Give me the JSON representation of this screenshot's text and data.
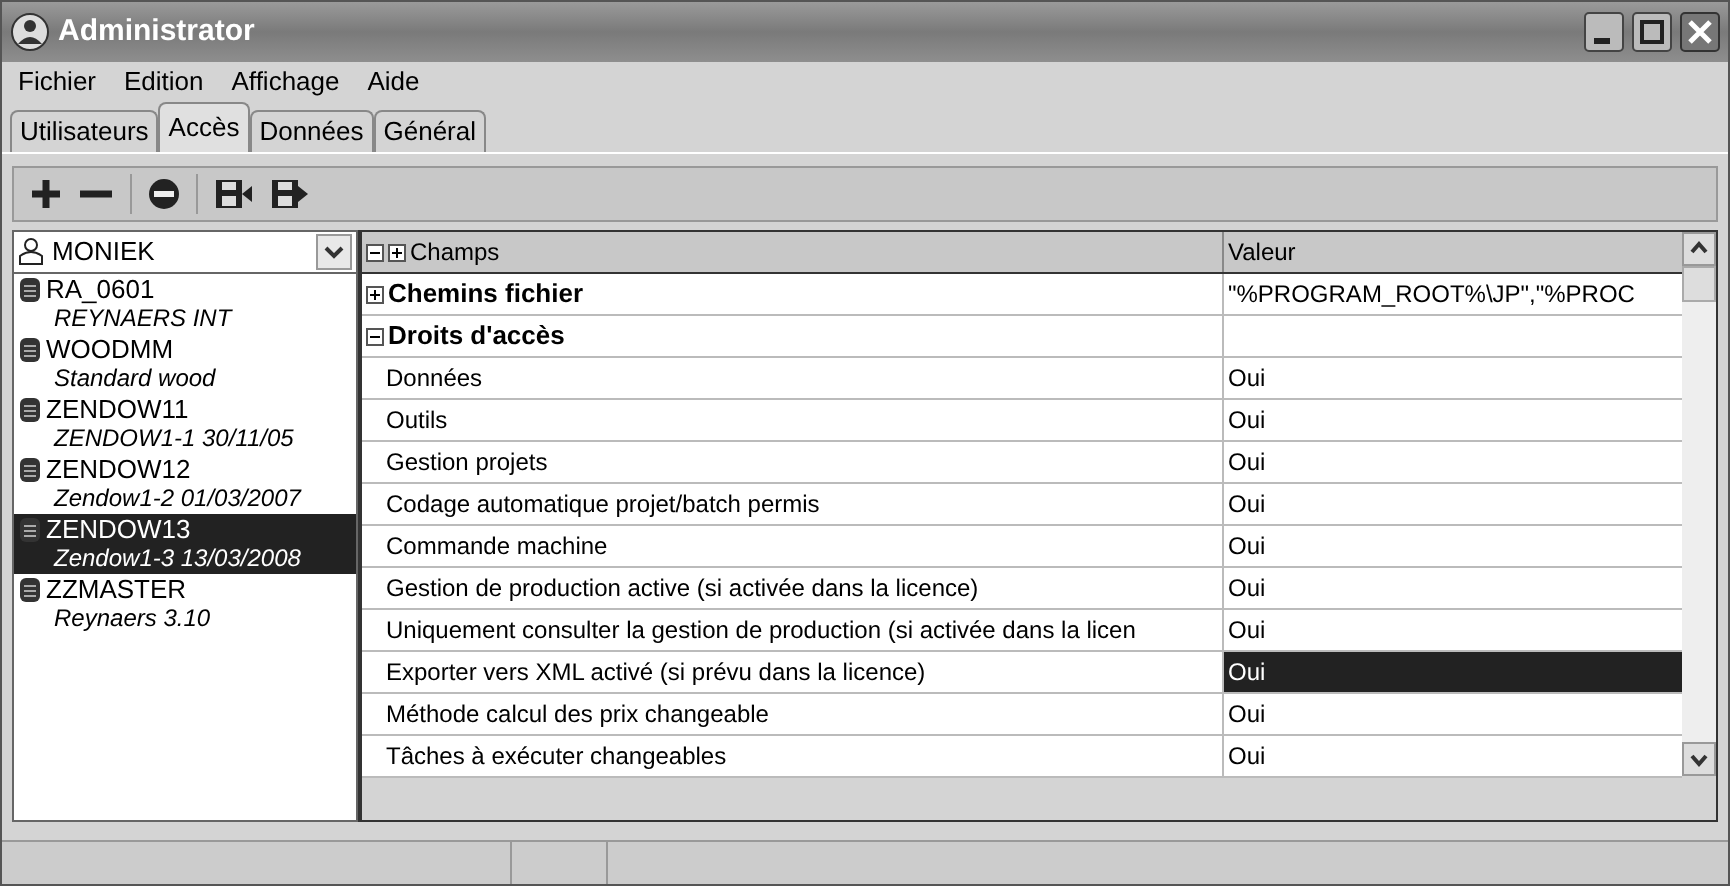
{
  "window": {
    "title": "Administrator"
  },
  "menu": [
    "Fichier",
    "Edition",
    "Affichage",
    "Aide"
  ],
  "tabs": [
    {
      "label": "Utilisateurs",
      "selected": false
    },
    {
      "label": "Accès",
      "selected": true
    },
    {
      "label": "Données",
      "selected": false
    },
    {
      "label": "Général",
      "selected": false
    }
  ],
  "user_select": {
    "value": "MONIEK"
  },
  "databases": [
    {
      "name": "RA_0601",
      "description": "REYNAERS INT",
      "selected": false
    },
    {
      "name": "WOODMM",
      "description": "Standard wood",
      "selected": false
    },
    {
      "name": "ZENDOW11",
      "description": "ZENDOW1-1 30/11/05",
      "selected": false
    },
    {
      "name": "ZENDOW12",
      "description": "Zendow1-2 01/03/2007",
      "selected": false
    },
    {
      "name": "ZENDOW13",
      "description": "Zendow1-3 13/03/2008",
      "selected": true
    },
    {
      "name": "ZZMASTER",
      "description": "Reynaers 3.10",
      "selected": false
    }
  ],
  "grid": {
    "columns": [
      "Champs",
      "Valeur"
    ],
    "rows": [
      {
        "kind": "group",
        "label": "Chemins fichier",
        "expanded": false,
        "value": "\"%PROGRAM_ROOT%\\JP\",\"%PROC"
      },
      {
        "kind": "group",
        "label": "Droits d'accès",
        "expanded": true
      },
      {
        "kind": "field",
        "label": "Données",
        "value": "Oui",
        "selected": false
      },
      {
        "kind": "field",
        "label": "Outils",
        "value": "Oui",
        "selected": false
      },
      {
        "kind": "field",
        "label": "Gestion projets",
        "value": "Oui",
        "selected": false
      },
      {
        "kind": "field",
        "label": "Codage automatique projet/batch permis",
        "value": "Oui",
        "selected": false
      },
      {
        "kind": "field",
        "label": "Commande machine",
        "value": "Oui",
        "selected": false
      },
      {
        "kind": "field",
        "label": "Gestion de production active (si activée dans la licence)",
        "value": "Oui",
        "selected": false
      },
      {
        "kind": "field",
        "label": "Uniquement consulter la gestion de production (si activée dans la licen",
        "value": "Oui",
        "selected": false
      },
      {
        "kind": "field",
        "label": "Exporter vers XML activé (si prévu dans la licence)",
        "value": "Oui",
        "selected": true
      },
      {
        "kind": "field",
        "label": "Méthode calcul des prix changeable",
        "value": "Oui",
        "selected": false
      },
      {
        "kind": "field",
        "label": "Tâches à exécuter changeables",
        "value": "Oui",
        "selected": false
      }
    ]
  }
}
